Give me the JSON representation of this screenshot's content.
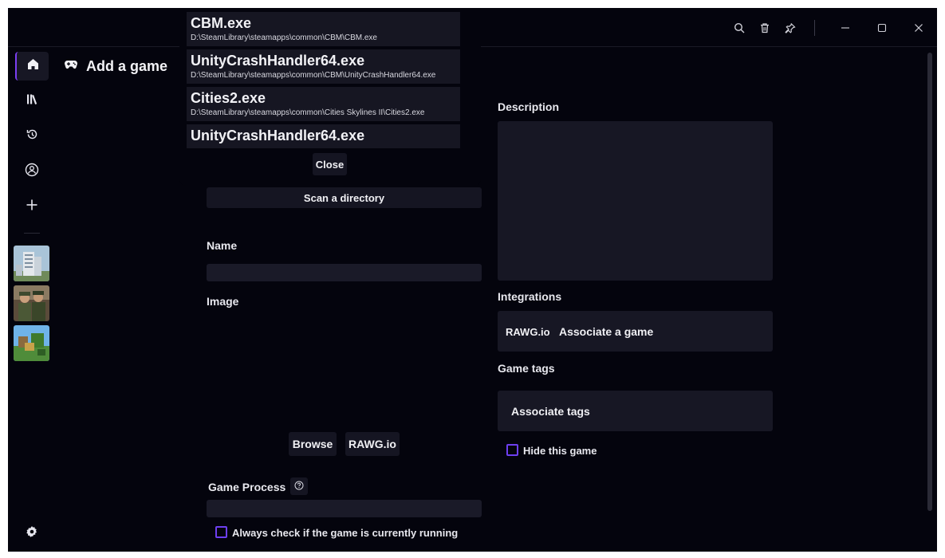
{
  "header": {
    "title": "Add a game"
  },
  "titlebar_icons": [
    "search-icon",
    "trash-icon",
    "pin-icon",
    "minimize-icon",
    "maximize-icon",
    "close-icon"
  ],
  "sidebar": {
    "items": [
      "home-icon",
      "library-icon",
      "history-icon",
      "profile-icon",
      "add-icon"
    ],
    "settings": "settings-icon"
  },
  "exe_popup": {
    "items": [
      {
        "name": "CBM.exe",
        "path": "D:\\SteamLibrary\\steamapps\\common\\CBM\\CBM.exe"
      },
      {
        "name": "UnityCrashHandler64.exe",
        "path": "D:\\SteamLibrary\\steamapps\\common\\CBM\\UnityCrashHandler64.exe"
      },
      {
        "name": "Cities2.exe",
        "path": "D:\\SteamLibrary\\steamapps\\common\\Cities Skylines II\\Cities2.exe"
      },
      {
        "name": "UnityCrashHandler64.exe",
        "path": ""
      }
    ],
    "close_label": "Close"
  },
  "form": {
    "scan_label": "Scan a directory",
    "name_label": "Name",
    "name_value": "",
    "image_label": "Image",
    "browse_label": "Browse",
    "rawg_label": "RAWG.io",
    "game_process_label": "Game Process",
    "game_process_value": "",
    "always_check_label": "Always check if the game is currently running",
    "description_label": "Description",
    "integrations_label": "Integrations",
    "integration_provider": "RAWG.io",
    "associate_game_label": "Associate a game",
    "game_tags_label": "Game tags",
    "associate_tags_label": "Associate tags",
    "hide_game_label": "Hide this game"
  },
  "colors": {
    "background": "#04040d",
    "field": "#1a1a28",
    "accent": "#7b3ff2"
  }
}
